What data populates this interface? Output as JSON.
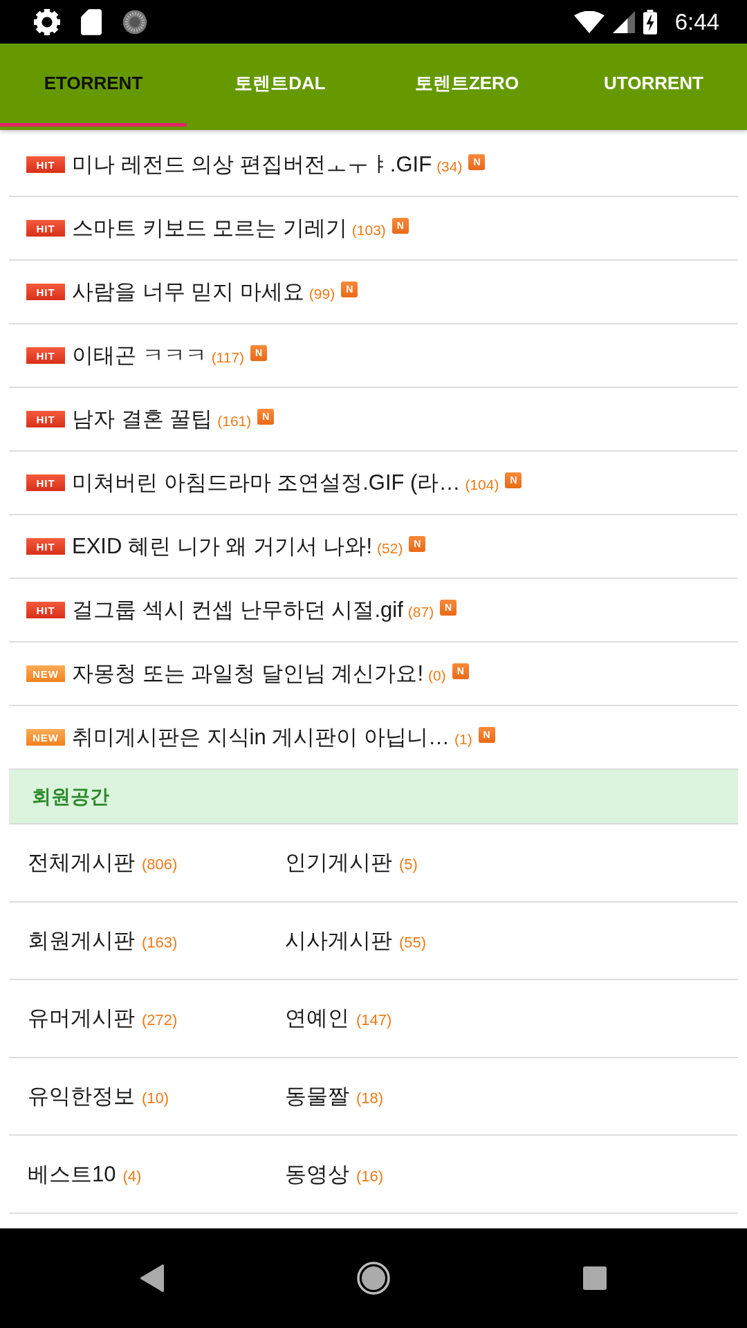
{
  "status_bar": {
    "time": "6:44"
  },
  "tabs": [
    {
      "label": "ETORRENT",
      "selected": true
    },
    {
      "label": "토렌트DAL",
      "selected": false
    },
    {
      "label": "토렌트ZERO",
      "selected": false
    },
    {
      "label": "UTORRENT",
      "selected": false
    }
  ],
  "posts": [
    {
      "kind": "hit",
      "badge": "HIT",
      "title": "미나 레전드 의상 편집버전ㅗㅜㅑ.GIF",
      "count": "(34)",
      "mark": "N"
    },
    {
      "kind": "hit",
      "badge": "HIT",
      "title": "스마트 키보드 모르는 기레기",
      "count": "(103)",
      "mark": "N"
    },
    {
      "kind": "hit",
      "badge": "HIT",
      "title": "사람을 너무 믿지 마세요",
      "count": "(99)",
      "mark": "N"
    },
    {
      "kind": "hit",
      "badge": "HIT",
      "title": "이태곤 ㅋㅋㅋ",
      "count": "(117)",
      "mark": "N"
    },
    {
      "kind": "hit",
      "badge": "HIT",
      "title": "남자 결혼 꿀팁",
      "count": "(161)",
      "mark": "N"
    },
    {
      "kind": "hit",
      "badge": "HIT",
      "title": "미쳐버린 아침드라마 조연설정.GIF (라…",
      "count": "(104)",
      "mark": "N"
    },
    {
      "kind": "hit",
      "badge": "HIT",
      "title": "EXID 혜린 니가 왜 거기서 나와!",
      "count": "(52)",
      "mark": "N"
    },
    {
      "kind": "hit",
      "badge": "HIT",
      "title": "걸그룹 섹시 컨셉 난무하던 시절.gif",
      "count": "(87)",
      "mark": "N"
    },
    {
      "kind": "new",
      "badge": "NEW",
      "title": "자몽청 또는 과일청 달인님 계신가요!",
      "count": "(0)",
      "mark": "N"
    },
    {
      "kind": "new",
      "badge": "NEW",
      "title": "취미게시판은 지식in 게시판이 아닙니…",
      "count": "(1)",
      "mark": "N"
    }
  ],
  "member_section": {
    "title": "회원공간",
    "boards": [
      {
        "name": "전체게시판",
        "count": "(806)"
      },
      {
        "name": "인기게시판",
        "count": "(5)"
      },
      {
        "name": "회원게시판",
        "count": "(163)"
      },
      {
        "name": "시사게시판",
        "count": "(55)"
      },
      {
        "name": "유머게시판",
        "count": "(272)"
      },
      {
        "name": "연예인",
        "count": "(147)"
      },
      {
        "name": "유익한정보",
        "count": "(10)"
      },
      {
        "name": "동물짤",
        "count": "(18)"
      },
      {
        "name": "베스트10",
        "count": "(4)"
      },
      {
        "name": "동영상",
        "count": "(16)"
      }
    ]
  }
}
